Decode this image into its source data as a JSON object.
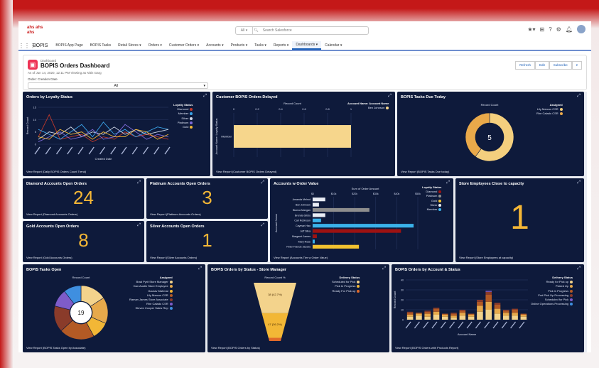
{
  "topbar": {
    "logo_line1": "ahs ahs",
    "logo_line2": "ahs",
    "search_scope": "All",
    "search_placeholder": "Search Salesforce"
  },
  "nav": {
    "app_name": "BOPIS",
    "items": [
      "BOPIS App Page",
      "BOPIS Tasks",
      "Retail Stores",
      "Orders",
      "Customer Orders",
      "Accounts",
      "Products",
      "Tasks",
      "Reports",
      "Dashboards",
      "Calendar"
    ],
    "active_index": 9
  },
  "header": {
    "object_type": "Dashboard",
    "title": "BOPIS Orders Dashboard",
    "subtitle": "As of Jun 14, 2020, 12:11 PM·Viewing as Nitin Garg",
    "filter_label": "Order: Creation Date",
    "filter_value": "All",
    "buttons": [
      "Refresh",
      "Edit",
      "Subscribe"
    ]
  },
  "tiles": {
    "loyalty": {
      "title": "Orders by Loyalty Status",
      "footer": "View Report (Daily BOPIS Orders Count Trend)",
      "xlabel": "Created Date",
      "ylabel": "Record Count",
      "legend_title": "Loyalty Status",
      "legend": [
        "Diamond",
        "Member",
        "Silver",
        "Platinum",
        "Gold"
      ]
    },
    "delayed": {
      "title": "Customer BOPIS Orders Delayed",
      "footer": "View Report (Customer BOPIS Orders Delayed)",
      "xlabel": "Record Count",
      "ylabel": "Account Name: Loyalty Status",
      "category": "Member",
      "legend_title": "Account Name: Account Name",
      "legend_item": "Ben Johnson"
    },
    "tasks_due": {
      "title": "BOPIS Tasks Due Today",
      "footer": "View Report (BOPIS Tasks Due today)",
      "measure": "Record Count",
      "center": "5",
      "legend_title": "Assigned",
      "legend": [
        "Lily Marcus CSR",
        "Rhe Calado CSR"
      ]
    },
    "diamond": {
      "title": "Diamond Accounts Open Orders",
      "value": "24",
      "footer": "View Report (Diamond Accounts Orders)"
    },
    "platinum": {
      "title": "Platinum Accounts Open Orders",
      "value": "3",
      "footer": "View Report (Platinum Accounts Orders)"
    },
    "gold": {
      "title": "Gold Accounts Open Orders",
      "value": "8",
      "footer": "View Report (Gold Accounts Orders)"
    },
    "silver": {
      "title": "Silver Accounts Open Orders",
      "value": "1",
      "footer": "View Report (Silver Accounts Orders)"
    },
    "accounts_value": {
      "title": "Accounts w Order Value",
      "footer": "View Report (Accounts Tier w Order Value)",
      "xlabel": "Sum of Order Amount",
      "ylabel": "Account Name",
      "legend_title": "Loyalty Status",
      "legend": [
        "Diamond",
        "Platinum",
        "Gold",
        "Silver",
        "Member"
      ]
    },
    "capacity": {
      "title": "Store Employees Close to capacity",
      "value": "1",
      "footer": "View Report (Store Employees at capacity)"
    },
    "tasks_open": {
      "title": "BOPIS Tasks Open",
      "footer": "View Report (BOPIS Tasks Open by Associate)",
      "measure": "Record Count",
      "center": "19",
      "legend_title": "Assigned",
      "legend": [
        "Brad Pyrit Store Manager",
        "Dan Austin Store Employee",
        "Gaurav Mahmal",
        "Lily Marcus CSR",
        "Raman James Store Associate",
        "Rhe Calado CSR",
        "Steven Cooper Sales Rep"
      ]
    },
    "by_status": {
      "title": "BOPIS Orders by Status - Store Manager",
      "footer": "View Report (BOPIS Orders by Status)",
      "measure": "Record Count %",
      "legend_title": "Delivery Status",
      "legend": [
        "Scheduled for Pick",
        "Pick In Progress",
        "Ready For Pick up"
      ],
      "labels": [
        "47 (36.2%)",
        "38 (42.7%)"
      ]
    },
    "by_account": {
      "title": "BOPIS Orders by Account & Status",
      "footer": "View Report (BOPIS Orders with Products Report)",
      "xlabel": "Account Name",
      "ylabel": "Record Count",
      "legend_title": "Delivery Status",
      "legend": [
        "Ready for Pick up",
        "Picked Up",
        "Pick in Progress",
        "Pod Pick Up Processing",
        "Scheduled for Pick",
        "Online Operations Processing"
      ]
    }
  },
  "chart_data": [
    {
      "type": "line",
      "title": "Orders by Loyalty Status",
      "xlabel": "Created Date",
      "ylabel": "Record Count",
      "ylim": [
        0,
        15
      ],
      "yticks": [
        0,
        5,
        10,
        15
      ],
      "series": [
        {
          "name": "Diamond",
          "values": [
            3,
            12,
            2,
            3,
            4,
            1,
            3,
            2,
            5,
            3,
            4,
            3,
            2
          ]
        },
        {
          "name": "Member",
          "values": [
            6,
            4,
            2,
            5,
            8,
            3,
            9,
            4,
            6,
            3,
            5,
            7,
            6
          ]
        },
        {
          "name": "Silver",
          "values": [
            2,
            5,
            4,
            7,
            3,
            5,
            4,
            7,
            4,
            6,
            4,
            5,
            6
          ]
        },
        {
          "name": "Platinum",
          "values": [
            1,
            3,
            5,
            2,
            3,
            6,
            2,
            3,
            8,
            5,
            2,
            4,
            3
          ]
        },
        {
          "name": "Gold",
          "values": [
            3,
            2,
            6,
            4,
            5,
            2,
            5,
            3,
            3,
            6,
            5,
            2,
            4
          ]
        }
      ],
      "colors": [
        "#c0392b",
        "#3aa3e8",
        "#cfd6e6",
        "#7d6ad8",
        "#f2b736"
      ]
    },
    {
      "type": "bar",
      "title": "Customer BOPIS Orders Delayed",
      "xlabel": "Record Count",
      "xlim": [
        0,
        1
      ],
      "xticks": [
        "0",
        "0.2",
        "0.4",
        "0.6",
        "0.8",
        "1"
      ],
      "categories": [
        "Member"
      ],
      "series": [
        {
          "name": "Ben Johnson",
          "values": [
            1
          ]
        }
      ],
      "colors": [
        "#f6d68c"
      ]
    },
    {
      "type": "pie",
      "title": "BOPIS Tasks Due Today",
      "categories": [
        "Lily Marcus CSR",
        "Rhe Calado CSR"
      ],
      "values": [
        3,
        2
      ],
      "colors": [
        "#f4cf7e",
        "#e9a94a"
      ]
    },
    {
      "type": "bar",
      "title": "Accounts w Order Value",
      "xlabel": "Sum of Order Amount",
      "xticks": [
        "$0",
        "$10k",
        "$20k",
        "$30k",
        "$40k",
        "$50k"
      ],
      "categories": [
        "Amanda Melrod",
        "Ben Johnson",
        "Bianca Mangan",
        "Brenda Gibbs",
        "Carl Robinson",
        "Cayman Hao",
        "Jeff Silva",
        "Margaret James",
        "Mary Rose",
        "Peter Francis Jacobs"
      ],
      "values": [
        6000,
        3000,
        27000,
        6000,
        4000,
        48000,
        42000,
        2000,
        1000,
        22000
      ],
      "tiers": [
        "Silver",
        "Silver",
        "Platinum",
        "Silver",
        "Member",
        "Member",
        "Diamond",
        "Diamond",
        "Member",
        "Gold"
      ],
      "colors": {
        "Diamond": "#9d1212",
        "Platinum": "#8e8e8e",
        "Gold": "#f2c230",
        "Silver": "#e9edf5",
        "Member": "#3ab2ea"
      }
    },
    {
      "type": "pie",
      "title": "BOPIS Tasks Open",
      "categories": [
        "Brad Pyrit Store Manager",
        "Dan Austin Store Employee",
        "Gaurav Mahmal",
        "Lily Marcus CSR",
        "Raman James Store Associate",
        "Rhe Calado CSR",
        "Steven Cooper Sales Rep"
      ],
      "values": [
        3,
        3,
        2,
        4,
        3,
        2,
        2
      ],
      "colors": [
        "#f3d38c",
        "#e6a94b",
        "#f2b736",
        "#b35a25",
        "#8a3b2a",
        "#7e5cc9",
        "#3f8fe0"
      ]
    },
    {
      "type": "bar",
      "title": "BOPIS Orders by Status - Store Manager",
      "categories": [
        "Scheduled for Pick",
        "Pick In Progress",
        "Ready For Pick up"
      ],
      "values": [
        47,
        38,
        5
      ],
      "colors": [
        "#f3d38c",
        "#f2b736",
        "#e06a2a"
      ]
    },
    {
      "type": "bar",
      "title": "BOPIS Orders by Account & Status",
      "xlabel": "Account Name",
      "ylabel": "Record Count",
      "ylim": [
        0,
        40
      ],
      "yticks": [
        0,
        10,
        20,
        30,
        40
      ],
      "categories": [
        "a1",
        "a2",
        "a3",
        "a4",
        "a5",
        "a6",
        "a7",
        "a8",
        "a9",
        "a10",
        "a11",
        "a12",
        "a13",
        "a14"
      ],
      "series": [
        {
          "name": "Ready for Pick up",
          "values": [
            3,
            4,
            3,
            5,
            3,
            2,
            4,
            3,
            8,
            10,
            6,
            4,
            4,
            3
          ]
        },
        {
          "name": "Picked Up",
          "values": [
            2,
            2,
            3,
            3,
            2,
            2,
            3,
            2,
            6,
            8,
            5,
            3,
            3,
            2
          ]
        },
        {
          "name": "Pick in Progress",
          "values": [
            2,
            1,
            2,
            3,
            1,
            2,
            2,
            1,
            4,
            7,
            4,
            2,
            3,
            1
          ]
        },
        {
          "name": "Pod Pick Up Processing",
          "values": [
            1,
            0,
            1,
            1,
            0,
            1,
            1,
            0,
            2,
            3,
            2,
            1,
            1,
            0
          ]
        },
        {
          "name": "Scheduled for Pick",
          "values": [
            0,
            0,
            0,
            0,
            0,
            0,
            0,
            0,
            0,
            1,
            0,
            0,
            0,
            0
          ]
        },
        {
          "name": "Online Operations Processing",
          "values": [
            0,
            0,
            0,
            0,
            0,
            0,
            0,
            0,
            0,
            0,
            0,
            0,
            0,
            0
          ]
        }
      ],
      "colors": [
        "#f3d38c",
        "#e6a94b",
        "#b35a25",
        "#8a3b2a",
        "#7e5cc9",
        "#3f8fe0"
      ]
    }
  ]
}
